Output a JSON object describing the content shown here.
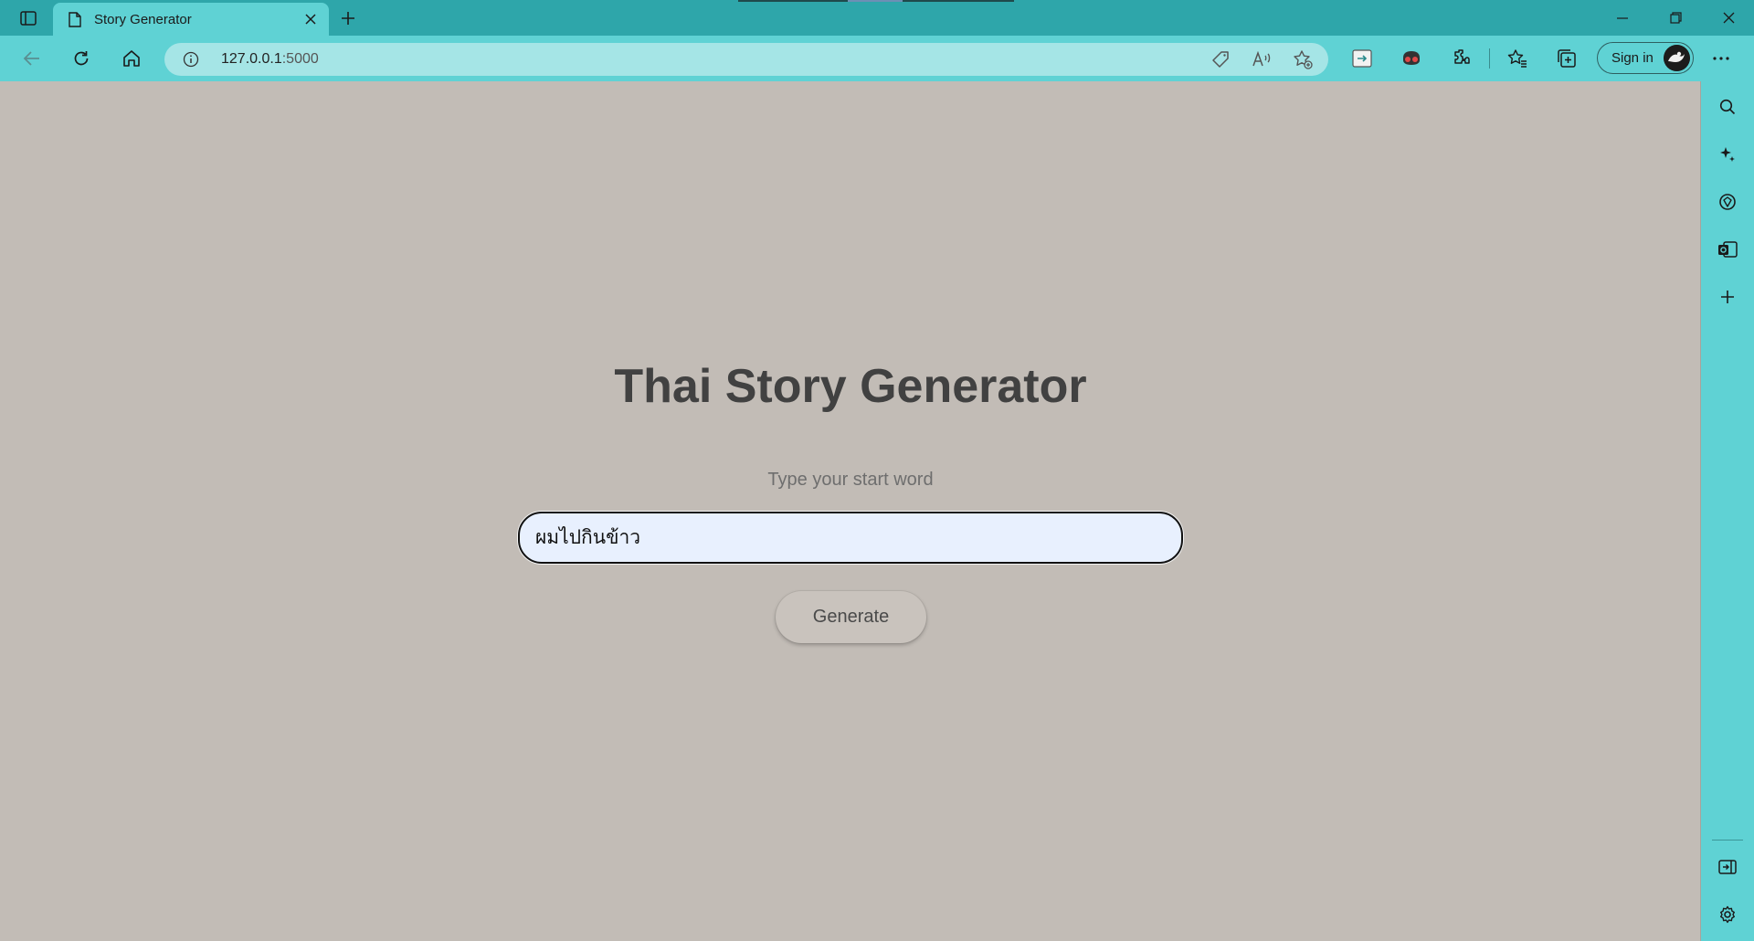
{
  "window": {
    "tab_title": "Story Generator"
  },
  "toolbar": {
    "url_host": "127.0.0.1",
    "url_port": ":5000",
    "signin_label": "Sign in"
  },
  "page": {
    "title": "Thai Story Generator",
    "prompt_label": "Type your start word",
    "input_value": "ผมไปกินข้าว",
    "generate_label": "Generate"
  },
  "colors": {
    "titlebar": "#2ea6aa",
    "toolbar": "#5fd2d4",
    "page_background": "#c2bcb6",
    "input_background": "#e8f0fe"
  }
}
